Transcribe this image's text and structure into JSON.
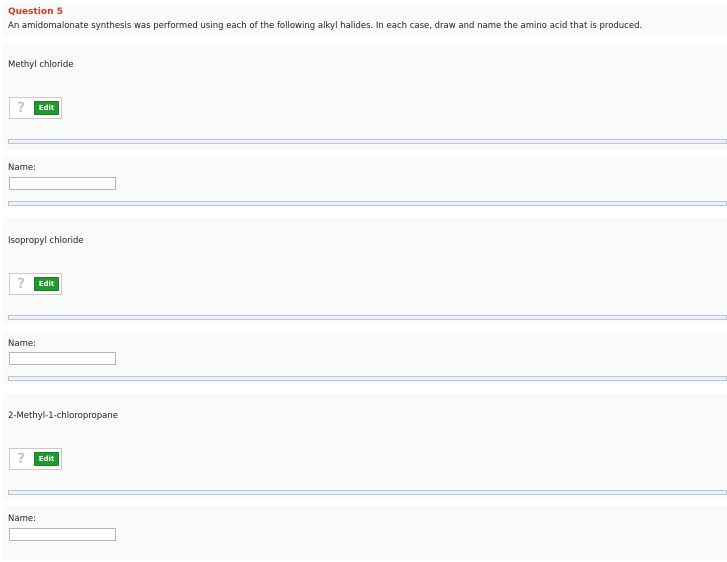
{
  "question": {
    "title": "Question 5",
    "text": "An amidomalonate synthesis was performed using each of the following alkyl halides. In each case, draw and name the amino acid that is produced."
  },
  "parts": [
    {
      "halide": "Methyl chloride",
      "help_glyph": "?",
      "edit_label": "Edit",
      "name_label": "Name:",
      "name_value": ""
    },
    {
      "halide": "Isopropyl chloride",
      "help_glyph": "?",
      "edit_label": "Edit",
      "name_label": "Name:",
      "name_value": ""
    },
    {
      "halide": "2-Methyl-1-chloropropane",
      "help_glyph": "?",
      "edit_label": "Edit",
      "name_label": "Name:",
      "name_value": ""
    }
  ],
  "colors": {
    "title_red": "#d13a1a",
    "edit_green": "#1f9a2c",
    "bar_fill": "#eef2f7",
    "bar_border": "#b8c6d6",
    "panel_bg": "#fafafa"
  }
}
